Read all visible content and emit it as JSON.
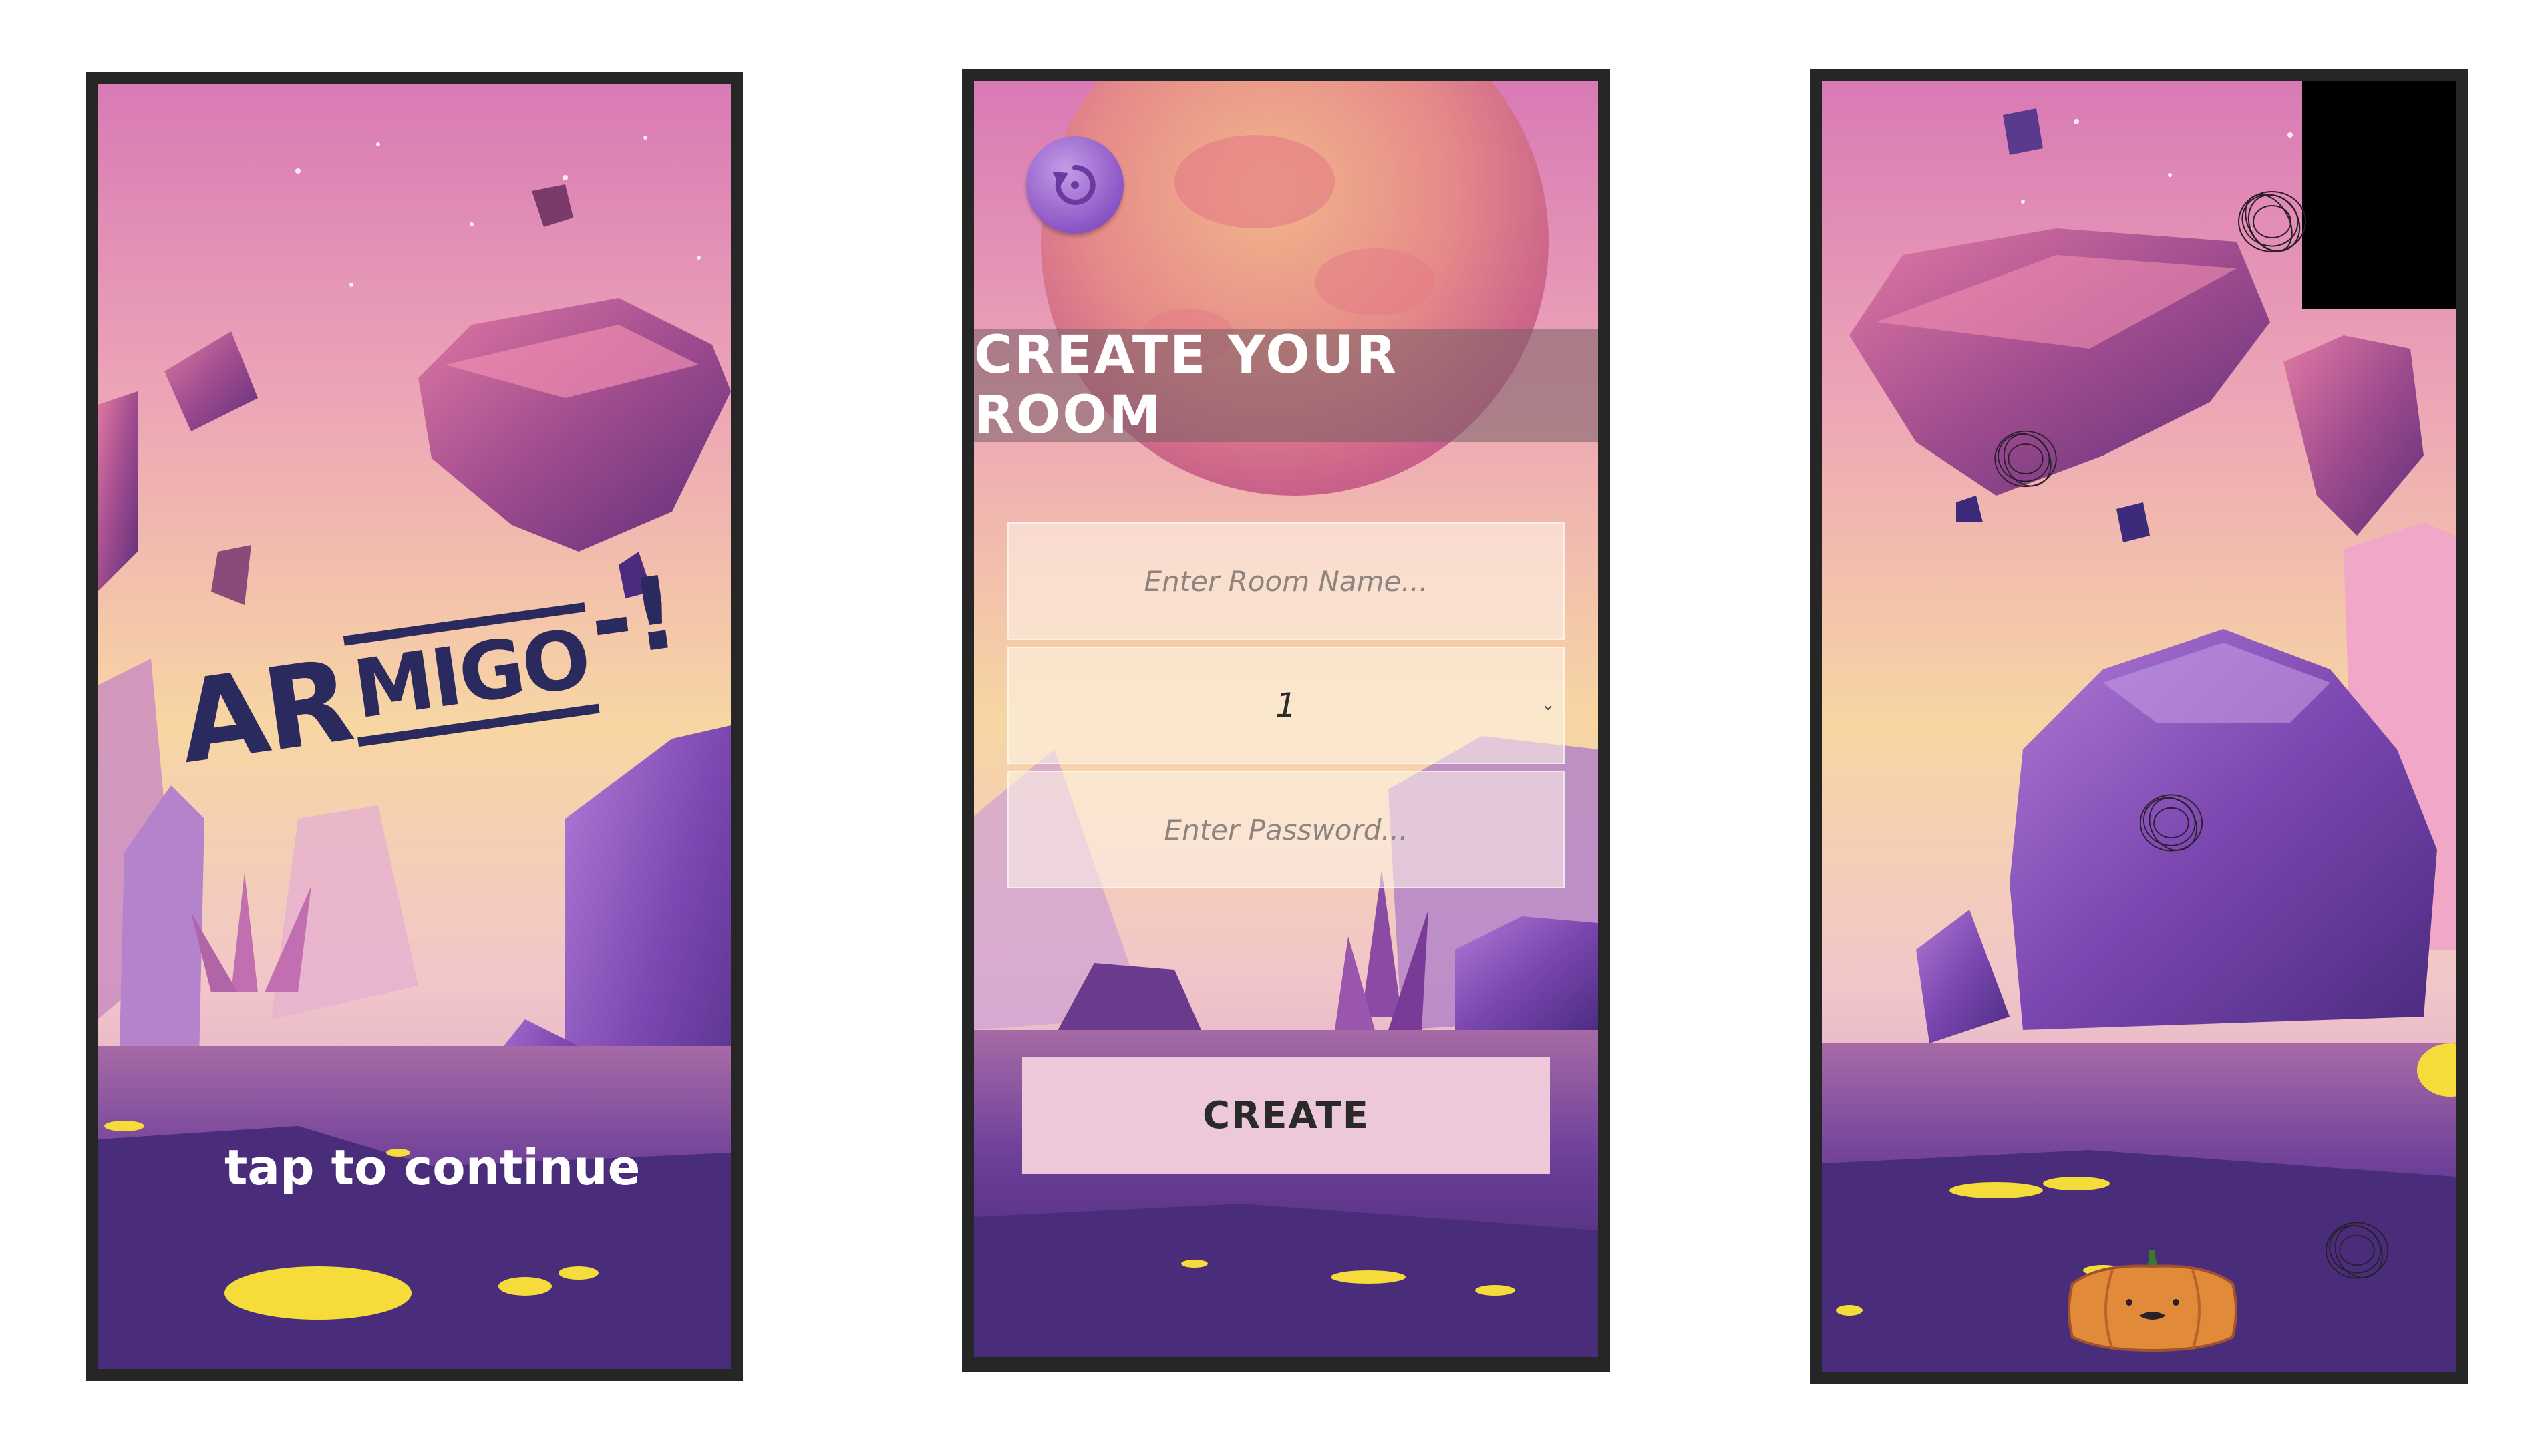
{
  "screens": [
    {
      "id": "splash",
      "logo": {
        "part1": "AR",
        "part2": "MIGO",
        "part3": "-!"
      },
      "tap_text": "tap to continue"
    },
    {
      "id": "create-room",
      "title": "CREATE YOUR ROOM",
      "room_name_placeholder": "Enter Room Name...",
      "player_count_value": "1",
      "password_placeholder": "Enter Password...",
      "create_label": "CREATE",
      "refresh_icon": "refresh-icon"
    },
    {
      "id": "game",
      "character_icon": "pumpkin-icon",
      "obstacle_icon": "scribble-ball-icon"
    }
  ],
  "colors": {
    "sky_top": "#e07bb8",
    "sky_mid": "#f6c79a",
    "ground": "#5b3a8e",
    "rock": "#9a4c8a",
    "lava": "#f5dc3a",
    "logo_navy": "#2a2a5e",
    "button_pink": "#ecc8d9",
    "phone_frame": "#262626"
  }
}
